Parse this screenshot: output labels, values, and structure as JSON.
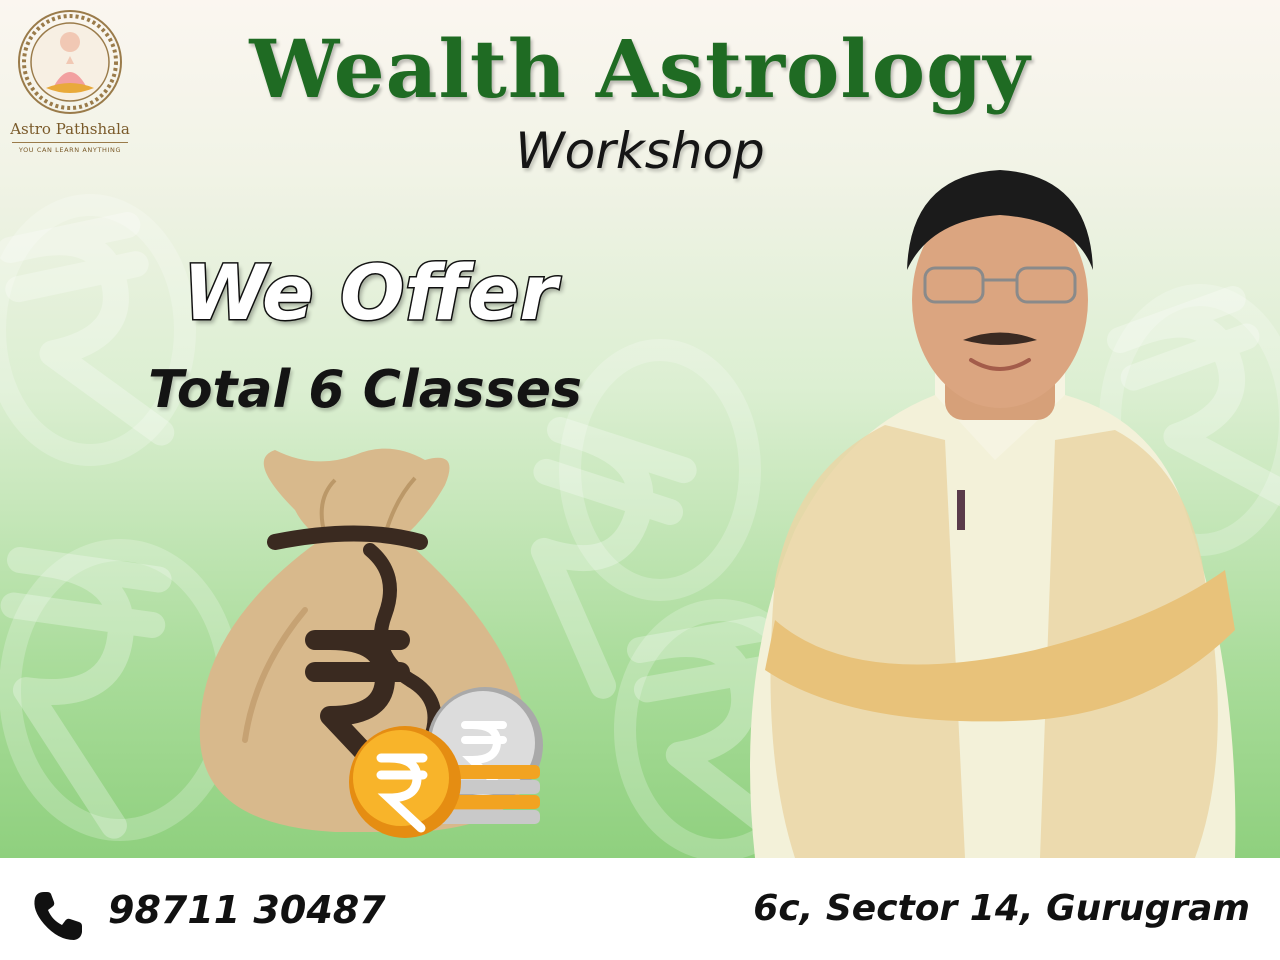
{
  "brand": {
    "name": "Astro Pathshala",
    "tagline": "YOU CAN LEARN ANYTHING"
  },
  "headline": {
    "title": "Wealth Astrology",
    "subtitle": "Workshop"
  },
  "offer": {
    "heading": "We Offer",
    "detail": "Total 6 Classes"
  },
  "contact": {
    "phone": "98711 30487",
    "address": "6c, Sector 14, Gurugram"
  },
  "icons": {
    "phone": "phone-icon",
    "currency": "rupee-icon",
    "bag": "money-bag-icon",
    "coin": "coin-icon"
  },
  "colors": {
    "title_green": "#1f6b23",
    "background_light": "#fbf6f0",
    "background_green": "#8fd07e",
    "bag": "#d8b98c",
    "coin_gold": "#f2a321",
    "coin_silver": "#c9c9c9",
    "text_dark": "#141414"
  }
}
